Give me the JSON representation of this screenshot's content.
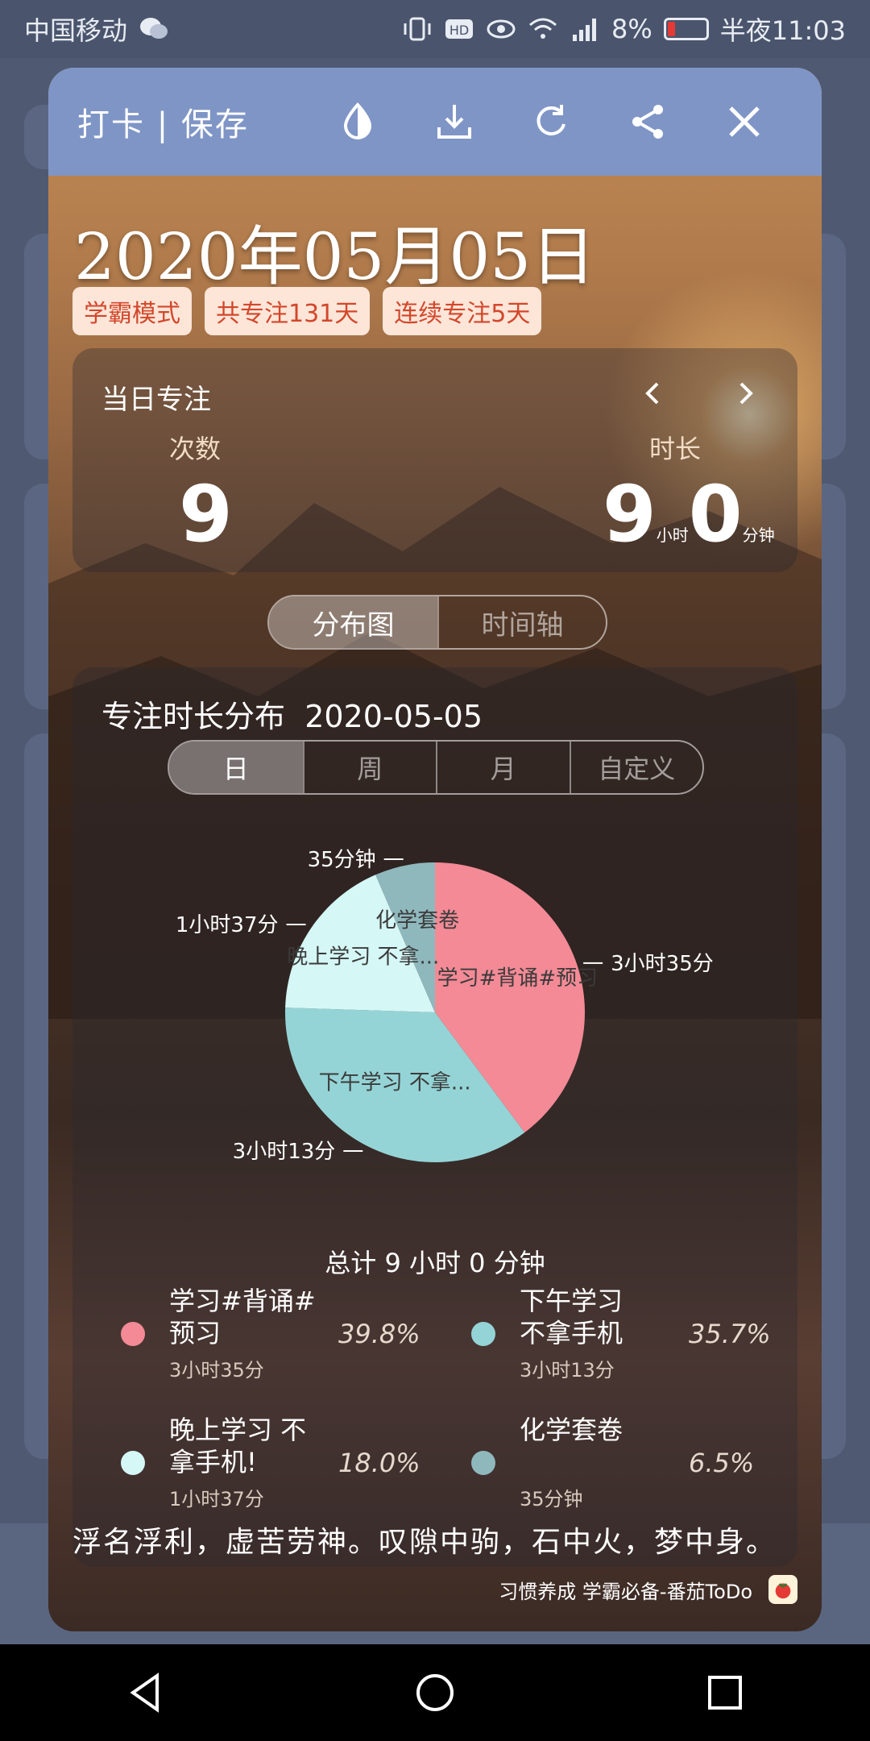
{
  "status_bar": {
    "carrier": "中国移动",
    "battery": "8%",
    "time": "半夜11:03"
  },
  "header": {
    "title": "打卡 | 保存",
    "icons": [
      "contrast-icon",
      "download-icon",
      "refresh-icon",
      "share-icon",
      "close-icon"
    ]
  },
  "summary": {
    "date": "2020年05月05日",
    "badges": [
      "学霸模式",
      "共专注131天",
      "连续专注5天"
    ]
  },
  "daily": {
    "title": "当日专注",
    "count_label": "次数",
    "count_value": "9",
    "duration_label": "时长",
    "hours_value": "9",
    "hours_unit": "小时",
    "minutes_value": "0",
    "minutes_unit": "分钟"
  },
  "view_tabs": [
    "分布图",
    "时间轴"
  ],
  "distribution": {
    "title": "专注时长分布",
    "date": "2020-05-05",
    "period_tabs": [
      "日",
      "周",
      "月",
      "自定义"
    ],
    "total": "总计 9 小时 0 分钟"
  },
  "chart_data": {
    "type": "pie",
    "slices": [
      {
        "name": "学习#背诵#预习",
        "short_label": "学习#背诵#预习",
        "percent": 39.8,
        "duration": "3小时35分",
        "color": "#f38a96"
      },
      {
        "name": "下午学习 不拿手机",
        "short_label": "下午学习 不拿...",
        "percent": 35.7,
        "duration": "3小时13分",
        "color": "#95d4d6"
      },
      {
        "name": "晚上学习 不拿手机!",
        "short_label": "晚上学习 不拿...",
        "percent": 18.0,
        "duration": "1小时37分",
        "color": "#d5f7f6"
      },
      {
        "name": "化学套卷",
        "short_label": "化学套卷",
        "percent": 6.5,
        "duration": "35分钟",
        "color": "#8fb8bd"
      }
    ]
  },
  "legend": [
    {
      "name_line1": "学习#背诵#",
      "name_line2": "预习",
      "pct": "39.8%",
      "time": "3小时35分"
    },
    {
      "name_line1": "下午学习",
      "name_line2": "不拿手机",
      "pct": "35.7%",
      "time": "3小时13分"
    },
    {
      "name_line1": "晚上学习 不",
      "name_line2": "拿手机!",
      "pct": "18.0%",
      "time": "1小时37分"
    },
    {
      "name_line1": "化学套卷",
      "name_line2": "",
      "pct": "6.5%",
      "time": "35分钟"
    }
  ],
  "quote": "浮名浮利，虚苦劳神。叹隙中驹，石中火，梦中身。",
  "footer_text": "习惯养成 学霸必备-番茄ToDo",
  "colors": {
    "header": "#7f95c6",
    "badge_bg": "#fde5d8",
    "badge_text": "#d2472b"
  }
}
